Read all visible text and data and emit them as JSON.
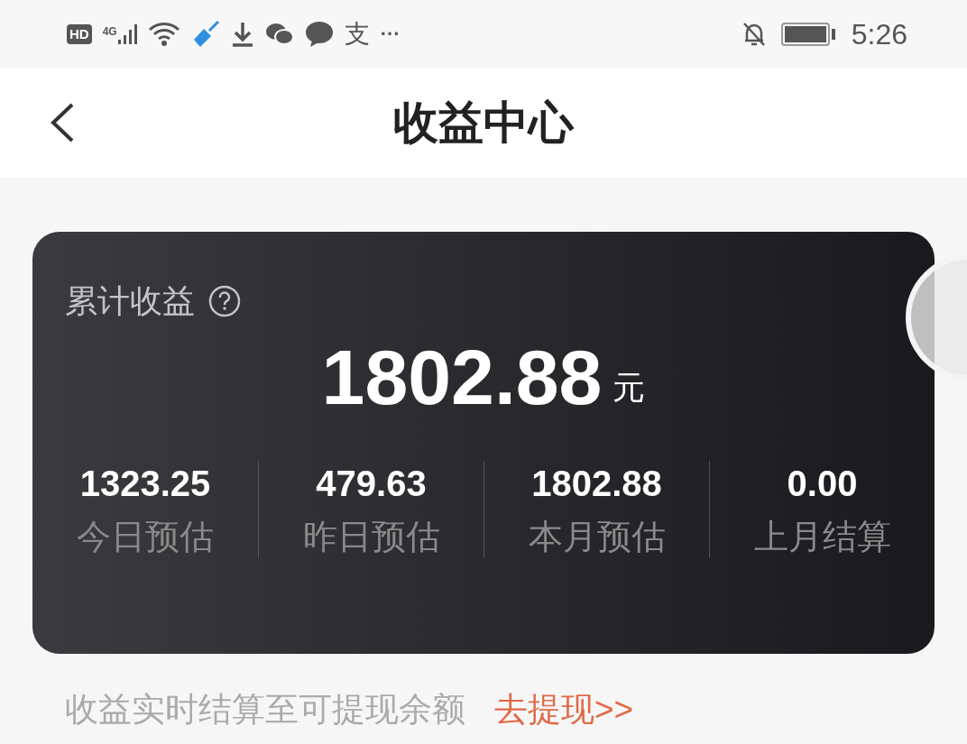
{
  "status_bar": {
    "hd": "HD",
    "network": "4G",
    "alipay": "支",
    "more": "···",
    "time": "5:26"
  },
  "header": {
    "title": "收益中心"
  },
  "earnings_card": {
    "label": "累计收益",
    "total": "1802.88",
    "unit": "元",
    "stats": [
      {
        "value": "1323.25",
        "label": "今日预估"
      },
      {
        "value": "479.63",
        "label": "昨日预估"
      },
      {
        "value": "1802.88",
        "label": "本月预估"
      },
      {
        "value": "0.00",
        "label": "上月结算"
      }
    ]
  },
  "footer": {
    "note": "收益实时结算至可提现余额",
    "link": "去提现>>"
  }
}
